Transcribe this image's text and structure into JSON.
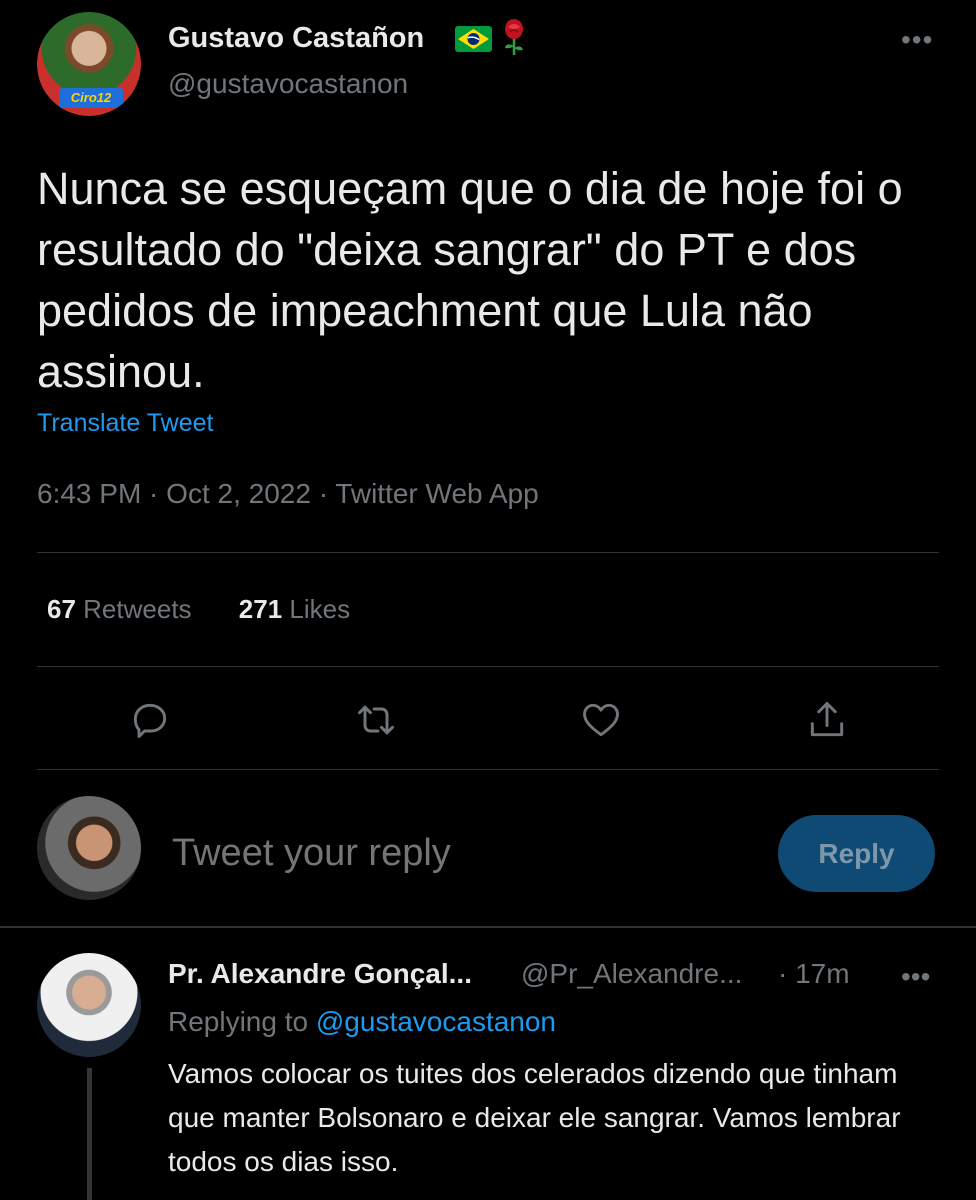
{
  "tweet": {
    "author_name": "Gustavo Castañon",
    "author_handle": "@gustavocastanon",
    "avatar_badge": "Ciro12",
    "text": "Nunca se esqueçam que o dia de hoje foi o resultado do \"deixa sangrar\" do PT e dos pedidos de impeachment que Lula não assinou.",
    "translate_label": "Translate Tweet",
    "meta": "6:43 PM · Oct 2, 2022 · Twitter Web App",
    "retweets_count": "67",
    "retweets_label": "Retweets",
    "likes_count": "271",
    "likes_label": "Likes",
    "more_label": "•••"
  },
  "composer": {
    "placeholder": "Tweet your reply",
    "reply_button": "Reply"
  },
  "reply": {
    "author_name": "Pr. Alexandre Gonçal...",
    "author_handle": "@Pr_Alexandre...",
    "time": "· 17m",
    "replying_label": "Replying to",
    "replying_to": "@gustavocastanon",
    "text": "Vamos colocar os tuites dos celerados dizendo que tinham que manter Bolsonaro e deixar ele sangrar. Vamos lembrar todos os dias isso.",
    "more_label": "•••"
  },
  "colors": {
    "background": "#000000",
    "text_primary": "#e7e9ea",
    "text_secondary": "#71767b",
    "accent": "#1d9bf0",
    "reply_button_bg": "#0e4a73",
    "divider": "#2f3336"
  },
  "icons": [
    "flag-brazil-icon",
    "rose-icon",
    "reply-icon",
    "retweet-icon",
    "like-icon",
    "share-icon",
    "more-icon"
  ]
}
